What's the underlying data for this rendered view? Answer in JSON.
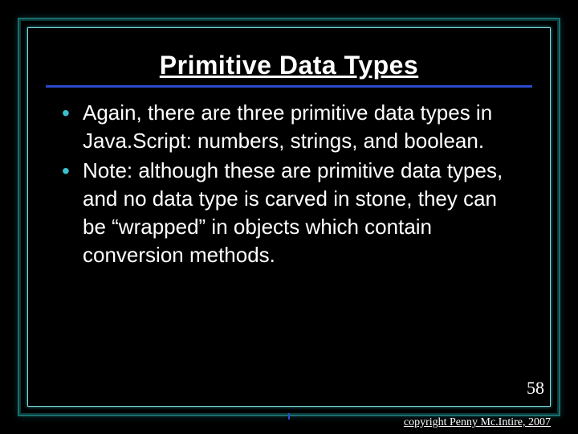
{
  "slide": {
    "title": "Primitive Data Types",
    "bullets": [
      "Again, there are three primitive data types in Java.Script: numbers, strings, and boolean.",
      "Note: although these are primitive data types, and no data type is carved in stone, they can be “wrapped” in objects which contain conversion methods."
    ],
    "page_number": "58",
    "copyright": "copyright Penny Mc.Intire, 2007"
  }
}
